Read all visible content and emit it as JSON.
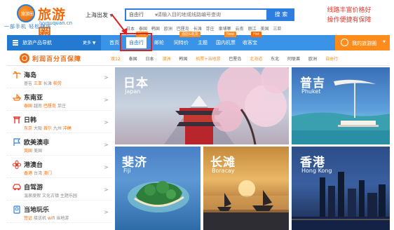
{
  "header": {
    "logo": {
      "badge_text": "旅游圈",
      "name": "旅游圈",
      "domain": "lvyouquan.cn",
      "slogan": "一部手机 轻松赚钱"
    },
    "city_selector": {
      "label": "上海出发",
      "caret": "▼"
    },
    "search": {
      "type_label": "自由行",
      "type_caret": "▼",
      "placeholder": "请输入目的地或线路编号查询",
      "button_label": "搜 索"
    },
    "hot_words": [
      "日本",
      "泰国",
      "韩国",
      "欧洲",
      "巴厘岛",
      "长滩",
      "芽庄",
      "柬埔寨",
      "云南",
      "丽江",
      "美国",
      "三亚"
    ],
    "promo_lines": [
      "线路丰富价格好",
      "操作便捷有保障"
    ]
  },
  "navbar": {
    "category_label": "旅游产品导航",
    "more_label": "更多 ▼",
    "items": [
      {
        "label": "首页"
      },
      {
        "label": "自由行",
        "tag": "New",
        "active": true
      },
      {
        "label": "邮轮"
      },
      {
        "label": "同特价",
        "tag": "酒店&机票"
      },
      {
        "label": "主题"
      },
      {
        "label": "国内机票",
        "tag": "New"
      },
      {
        "label": "收客宝",
        "tag": "Hot"
      }
    ],
    "user_label": "我的旅游圈",
    "user_caret": "▼"
  },
  "subbar": {
    "brand": "利润百分百保障",
    "tabs": [
      "双12",
      "泰国",
      "日本",
      "澳洲",
      "韩国",
      "机票+当地游",
      "巴厘岛",
      "北海道",
      "东北",
      "阿联酋",
      "欧洲",
      "自由行"
    ],
    "selected_tab": "双12",
    "orange_tabs": [
      "澳洲",
      "机票+当地游",
      "北海道",
      "自由行"
    ]
  },
  "sidebar": {
    "items": [
      {
        "title": "海岛",
        "subs": [
          "普吉",
          "三亚",
          "长滩",
          "帕劳"
        ],
        "highlights": [
          "三亚",
          "帕劳"
        ],
        "icon": "island-icon",
        "color": "#ff7a1a"
      },
      {
        "title": "东南亚",
        "subs": [
          "泰国",
          "越南",
          "巴厘岛",
          "芽庄"
        ],
        "highlights": [
          "泰国",
          "巴厘岛"
        ],
        "icon": "boat-icon",
        "color": "#ff7a1a"
      },
      {
        "title": "日韩",
        "subs": [
          "东京",
          "大阪",
          "首尔",
          "九州",
          "冲绳"
        ],
        "highlights": [
          "东京",
          "首尔",
          "冲绳"
        ],
        "icon": "torii-icon",
        "color": "#e4382c"
      },
      {
        "title": "欧美澳非",
        "subs": [
          "英国",
          "美国"
        ],
        "highlights": [
          "英国"
        ],
        "icon": "flag-icon",
        "color": "#2e7ee0"
      },
      {
        "title": "港澳台",
        "subs": [
          "香港",
          "台湾",
          "澳门"
        ],
        "highlights": [
          "香港",
          "澳门"
        ],
        "icon": "flower-icon",
        "color": "#e4382c"
      },
      {
        "title": "自驾游",
        "subs": [
          "温泉度假",
          "文化古镇",
          "主题乐园"
        ],
        "highlights": [],
        "icon": "car-icon",
        "color": "#e4382c"
      },
      {
        "title": "当地玩乐",
        "subs": [
          "签证",
          "接送机",
          "wifi",
          "当地游"
        ],
        "highlights": [
          "签证",
          "wifi"
        ],
        "icon": "passport-icon",
        "color": "#2e7ee0"
      }
    ],
    "arrow": ">"
  },
  "tiles": {
    "japan": {
      "zh": "日本",
      "en": "Japan"
    },
    "phuket": {
      "zh": "普吉",
      "en": "Phuket"
    },
    "jeju": {
      "zh": "斐济",
      "en": "Fiji"
    },
    "boracay": {
      "zh": "长滩",
      "en": "Boracay"
    },
    "hongkong": {
      "zh": "香港",
      "en": "Hong Kong"
    }
  },
  "colors": {
    "brand_orange": "#f06a0e",
    "nav_blue": "#3a93e6",
    "nav_dark_blue": "#2479d1",
    "accent_orange": "#ff8c1a",
    "annotation_red": "#e02020"
  }
}
